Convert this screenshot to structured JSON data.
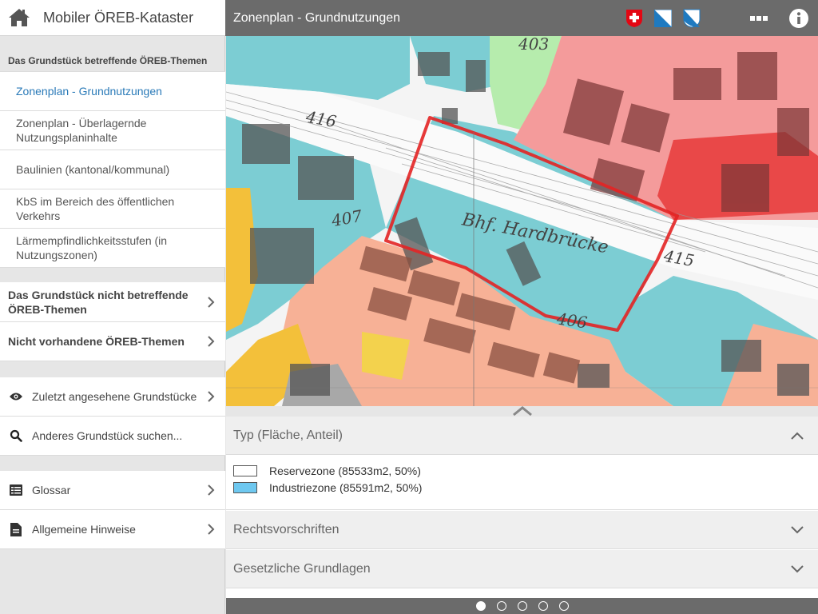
{
  "app": {
    "title": "Mobiler ÖREB-Kataster"
  },
  "sidebar": {
    "concerning_title": "Das Grundstück betreffende ÖREB-Themen",
    "themes": [
      {
        "label": "Zonenplan - Grundnutzungen",
        "active": true
      },
      {
        "label": "Zonenplan - Überlagernde Nutzungsplaninhalte",
        "active": false
      },
      {
        "label": "Baulinien (kantonal/kommunal)",
        "active": false
      },
      {
        "label": "KbS im Bereich des öffentlichen Verkehrs",
        "active": false
      },
      {
        "label": "Lärmempfindlichkeitsstufen (in Nutzungszonen)",
        "active": false
      }
    ],
    "not_concerning": "Das Grundstück nicht betreffende ÖREB-Themen",
    "not_available": "Nicht vorhandene ÖREB-Themen",
    "recent": "Zuletzt angesehene Grundstücke",
    "search": "Anderes Grundstück suchen...",
    "glossary": "Glossar",
    "notes": "Allgemeine Hinweise"
  },
  "topbar": {
    "title": "Zonenplan - Grundnutzungen"
  },
  "map": {
    "labels": {
      "station": "Bhf. Hardbrücke",
      "n416": "416",
      "n407": "407",
      "n403": "403",
      "n415": "415",
      "n406": "406"
    }
  },
  "panel": {
    "type_header": "Typ (Fläche, Anteil)",
    "legend": [
      {
        "label": "Reservezone (85533m2, 50%)",
        "color": "#ffffff"
      },
      {
        "label": "Industriezone (85591m2, 50%)",
        "color": "#6ec8f0"
      }
    ],
    "rechts_header": "Rechtsvorschriften",
    "gesetz_header": "Gesetzliche Grundlagen"
  },
  "pager": {
    "count": 5,
    "active": 0
  },
  "colors": {
    "topbar": "#6b6b6b",
    "link_active": "#2a7ab8",
    "industry": "#7ccdd3",
    "residential": "#f4a886",
    "core": "#f28b8b",
    "green": "#9ee39a",
    "yellow": "#f3c03a",
    "parcel_outline": "#e32424"
  }
}
